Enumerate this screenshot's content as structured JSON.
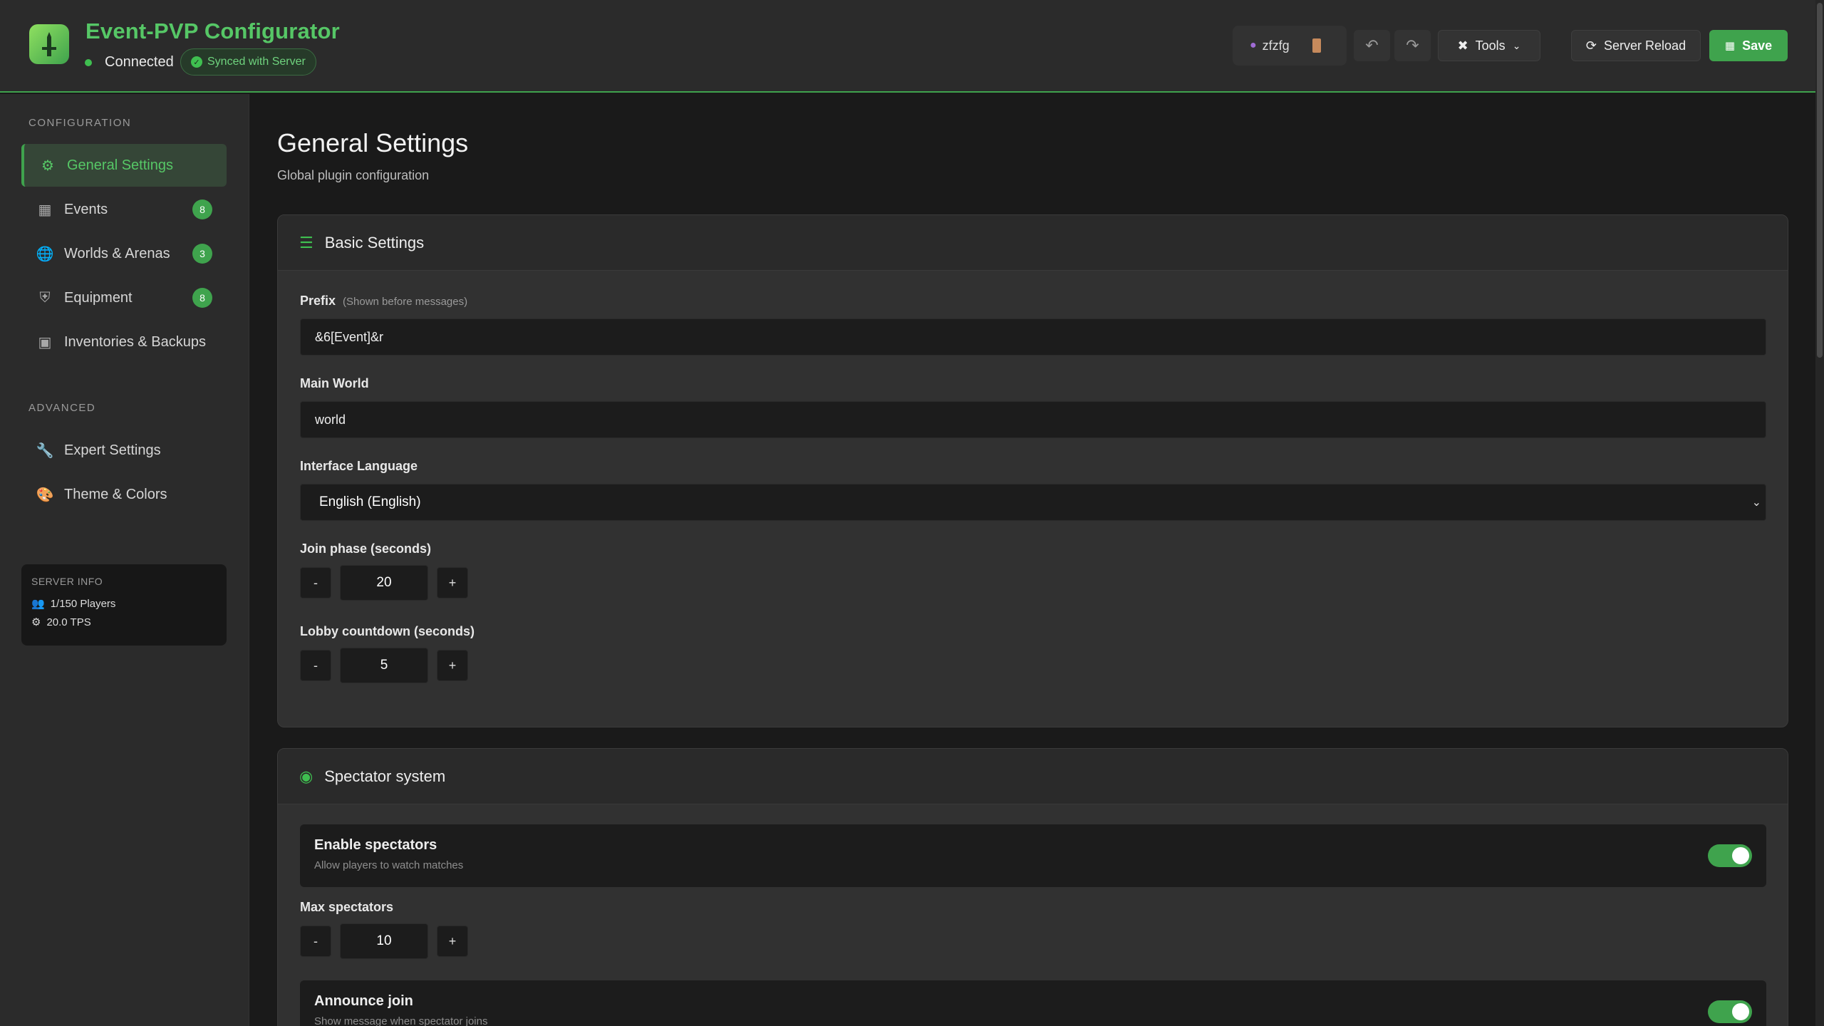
{
  "header": {
    "app_title": "Event-PVP Configurator",
    "connection_status": "Connected",
    "sync_status": "Synced with Server",
    "user": "zfzfg",
    "tools_label": "Tools",
    "reload_label": "Server Reload",
    "save_label": "Save",
    "accent_color": "#3fa34d"
  },
  "sidebar": {
    "config_section": "CONFIGURATION",
    "advanced_section": "ADVANCED",
    "items": [
      {
        "label": "General Settings",
        "icon": "gear-icon",
        "active": true
      },
      {
        "label": "Events",
        "icon": "calendar-icon",
        "count": "8"
      },
      {
        "label": "Worlds & Arenas",
        "icon": "globe-icon",
        "count": "3"
      },
      {
        "label": "Equipment",
        "icon": "shield-icon",
        "count": "8"
      },
      {
        "label": "Inventories & Backups",
        "icon": "boxes-icon"
      }
    ],
    "advanced_items": [
      {
        "label": "Expert Settings",
        "icon": "wrench-icon"
      },
      {
        "label": "Theme & Colors",
        "icon": "palette-icon"
      }
    ],
    "server_info": {
      "title": "SERVER INFO",
      "players": "1/150 Players",
      "tps": "20.0 TPS"
    }
  },
  "main": {
    "title": "General Settings",
    "subtitle": "Global plugin configuration",
    "basic": {
      "title": "Basic Settings",
      "prefix_label": "Prefix",
      "prefix_hint": "(Shown before messages)",
      "prefix_value": "&6[Event]&r",
      "world_label": "Main World",
      "world_value": "world",
      "lang_label": "Interface Language",
      "lang_value": "English (English)",
      "join_label": "Join phase (seconds)",
      "join_value": "20",
      "lobby_label": "Lobby countdown (seconds)",
      "lobby_value": "5",
      "minus": "-",
      "plus": "+"
    },
    "spectator": {
      "title": "Spectator system",
      "enable_title": "Enable spectators",
      "enable_desc": "Allow players to watch matches",
      "enable_on": true,
      "max_label": "Max spectators",
      "max_value": "10",
      "announce_title": "Announce join",
      "announce_desc": "Show message when spectator joins",
      "announce_on": true
    }
  }
}
